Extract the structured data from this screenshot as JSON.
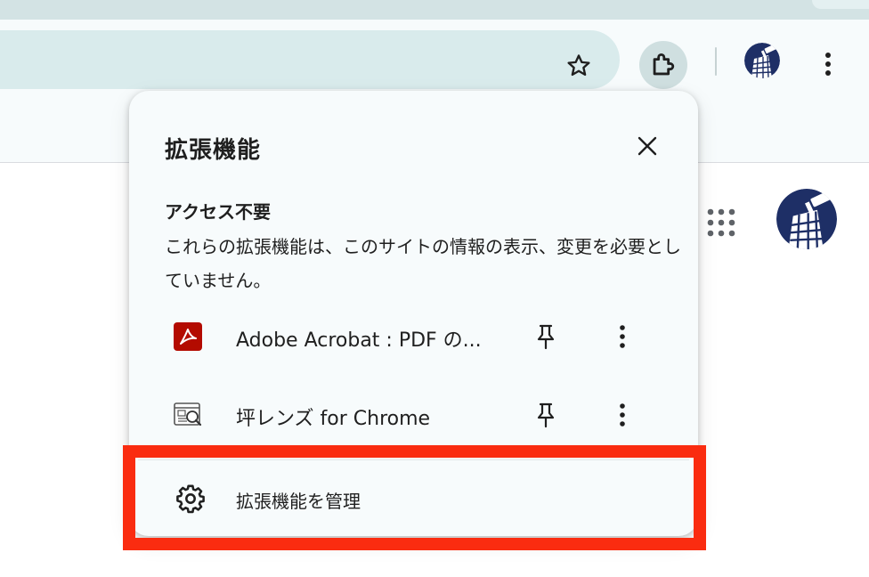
{
  "popup": {
    "title": "拡張機能",
    "section_title": "アクセス不要",
    "section_description": "これらの拡張機能は、このサイトの情報の表示、変更を必要としていません。",
    "extensions": [
      {
        "name": "Adobe Acrobat : PDF の...",
        "icon": "adobe-acrobat-icon"
      },
      {
        "name": "坪レンズ for Chrome",
        "icon": "tsubo-lens-icon"
      }
    ],
    "manage_label": "拡張機能を管理"
  },
  "colors": {
    "highlight": "#fa2c10",
    "popup_bg": "#f7fbfc",
    "omnibox_bg": "#d9ebec",
    "adobe_red": "#b30b00",
    "avatar_navy": "#1e2f66"
  }
}
